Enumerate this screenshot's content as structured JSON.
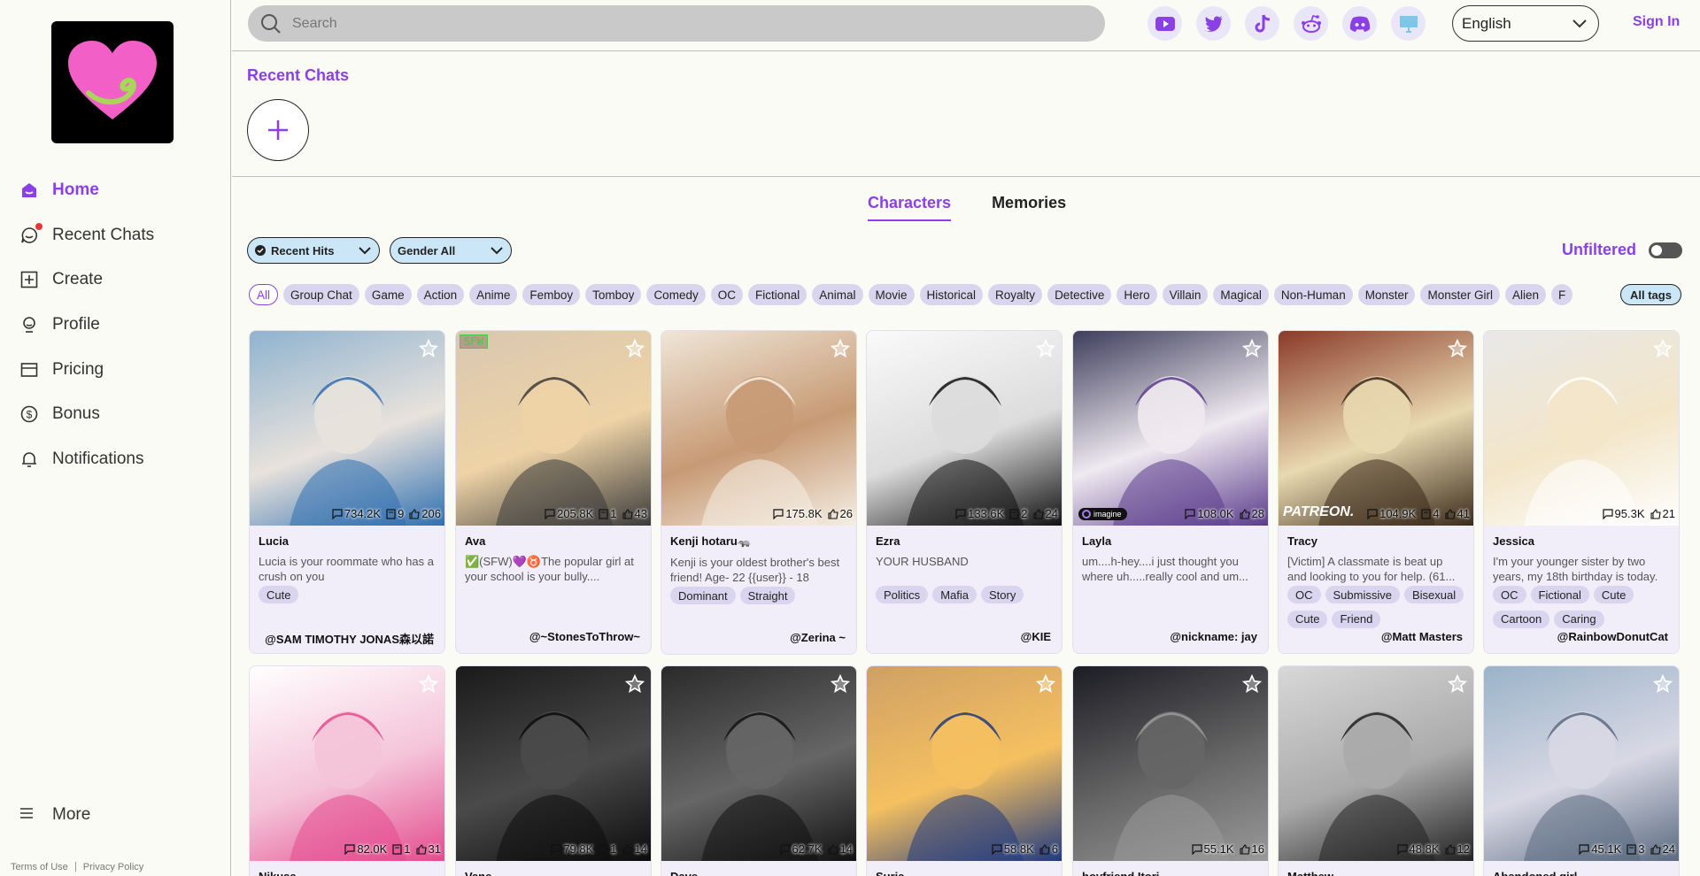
{
  "sidebar": {
    "items": [
      {
        "label": "Home",
        "icon": "home-icon"
      },
      {
        "label": "Recent Chats",
        "icon": "chat-icon"
      },
      {
        "label": "Create",
        "icon": "plus-square-icon"
      },
      {
        "label": "Profile",
        "icon": "profile-icon"
      },
      {
        "label": "Pricing",
        "icon": "card-icon"
      },
      {
        "label": "Bonus",
        "icon": "coin-icon"
      },
      {
        "label": "Notifications",
        "icon": "bell-icon"
      }
    ],
    "more": "More",
    "terms": "Terms of Use",
    "privacy": "Privacy Policy"
  },
  "header": {
    "search_placeholder": "Search",
    "language": "English",
    "sign_in": "Sign In",
    "socials": [
      "youtube-icon",
      "twitter-icon",
      "tiktok-icon",
      "reddit-icon",
      "discord-icon",
      "desktop-icon"
    ]
  },
  "recent": {
    "title": "Recent Chats"
  },
  "tabs": [
    "Characters",
    "Memories"
  ],
  "filters": {
    "recent_hits": "Recent Hits",
    "gender": "Gender All",
    "unfiltered": "Unfiltered"
  },
  "tags": [
    "All",
    "Group Chat",
    "Game",
    "Action",
    "Anime",
    "Femboy",
    "Tomboy",
    "Comedy",
    "OC",
    "Fictional",
    "Animal",
    "Movie",
    "Historical",
    "Royalty",
    "Detective",
    "Hero",
    "Villain",
    "Magical",
    "Non-Human",
    "Monster",
    "Monster Girl",
    "Alien",
    "F"
  ],
  "all_tags": "All tags",
  "cards": [
    {
      "name": "Lucia",
      "desc": "Lucia is your roommate who has a crush on you",
      "tags": [
        "Cute"
      ],
      "author": "@SAM TIMOTHY JONAS森以諾",
      "chats": "734.2K",
      "mem": "9",
      "likes": "206"
    },
    {
      "name": "Ava",
      "desc": "✅(SFW)💜♉The popular girl at your school is your bully....",
      "tags": [],
      "author": "@~StonesToThrow~",
      "chats": "205.8K",
      "mem": "1",
      "likes": "43",
      "sfw": "SFW"
    },
    {
      "name": "Kenji hotaru🦡",
      "desc": "Kenji is your oldest brother's best friend! Age- 22 {{user}} - 18",
      "tags": [
        "Dominant",
        "Straight"
      ],
      "author": "@Zerina ~",
      "chats": "175.8K",
      "mem": "",
      "likes": "26"
    },
    {
      "name": "Ezra",
      "desc": "YOUR HUSBAND",
      "tags": [
        "Politics",
        "Mafia",
        "Story"
      ],
      "author": "@KIE",
      "chats": "133.6K",
      "mem": "2",
      "likes": "24"
    },
    {
      "name": "Layla",
      "desc": "um....h-hey....i just thought you where uh.....really cool and um...",
      "tags": [],
      "author": "@nickname: jay",
      "chats": "108.0K",
      "mem": "",
      "likes": "28",
      "badge": "imagine"
    },
    {
      "name": "Tracy",
      "desc": "[Victim] A classmate is beat up and looking to you for help. (61...",
      "tags": [
        "OC",
        "Submissive",
        "Bisexual",
        "Cute",
        "Friend"
      ],
      "author": "@Matt Masters",
      "chats": "104.9K",
      "mem": "4",
      "likes": "41",
      "label": "PATREON."
    },
    {
      "name": "Jessica",
      "desc": "I'm your younger sister by two years, my 18th birthday is today.",
      "tags": [
        "OC",
        "Fictional",
        "Cute",
        "Cartoon",
        "Caring"
      ],
      "author": "@RainbowDonutCat",
      "chats": "95.3K",
      "mem": "",
      "likes": "21"
    },
    {
      "name": "Nikusa",
      "chats": "82.0K",
      "mem": "1",
      "likes": "31"
    },
    {
      "name": "Vane",
      "chats": "79.8K",
      "mem": "1",
      "likes": "14"
    },
    {
      "name": "Dave",
      "chats": "62.7K",
      "mem": "",
      "likes": "14"
    },
    {
      "name": "Suria",
      "chats": "58.8K",
      "mem": "",
      "likes": "6"
    },
    {
      "name": "boyfriend Itori",
      "chats": "55.1K",
      "mem": "",
      "likes": "16"
    },
    {
      "name": "Matthew",
      "chats": "48.8K",
      "mem": "",
      "likes": "12"
    },
    {
      "name": "Abandoned girl",
      "chats": "45.1K",
      "mem": "3",
      "likes": "24"
    }
  ],
  "colors": {
    "accent": "#8b3fe6",
    "tag_bg": "#d9d5ef",
    "filter_bg": "#cbe6f6",
    "card_bg": "#f1eef9"
  }
}
